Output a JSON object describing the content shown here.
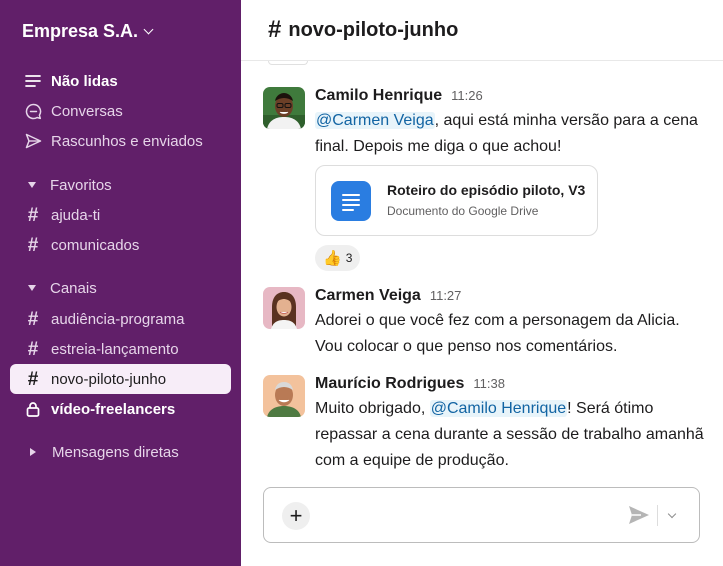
{
  "workspace": {
    "name": "Empresa S.A."
  },
  "sidebar": {
    "top_items": [
      {
        "label": "Não lidas",
        "icon": "unread-icon"
      },
      {
        "label": "Conversas",
        "icon": "threads-icon"
      },
      {
        "label": "Rascunhos e enviados",
        "icon": "send-icon"
      }
    ],
    "favorites": {
      "title": "Favoritos",
      "channels": [
        "ajuda-ti",
        "comunicados"
      ]
    },
    "channels": {
      "title": "Canais",
      "items": [
        "audiência-programa",
        "estreia-lançamento",
        "novo-piloto-junho",
        "vídeo-freelancers"
      ]
    },
    "direct_messages": {
      "title": "Mensagens diretas"
    }
  },
  "channel": {
    "name": "novo-piloto-junho"
  },
  "messages": [
    {
      "author": "Camilo Henrique",
      "time": "11:26",
      "mention": "@Carmen Veiga",
      "text_after": ", aqui está minha versão para a cena final. Depois me diga o que achou!",
      "attachment": {
        "title": "Roteiro do episódio piloto, V3",
        "subtitle": "Documento do Google Drive"
      },
      "reaction": {
        "emoji": "👍",
        "count": "3"
      }
    },
    {
      "author": "Carmen Veiga",
      "time": "11:27",
      "text": "Adorei o que você fez com a personagem da Alicia. Vou colocar o que penso nos comentários."
    },
    {
      "author": "Maurício Rodrigues",
      "time": "11:38",
      "text_before": "Muito obrigado, ",
      "mention": "@Camilo Henrique",
      "text_after": "! Será ótimo repassar a cena durante a sessão de trabalho amanhã com a equipe de produção."
    }
  ],
  "composer": {
    "plus_label": "+"
  },
  "colors": {
    "sidebar_bg": "#611f69",
    "active_item_bg": "#f7edf8",
    "mention_bg": "#e8f4fa",
    "mention_text": "#1264a3",
    "doc_icon": "#2a7de1"
  }
}
